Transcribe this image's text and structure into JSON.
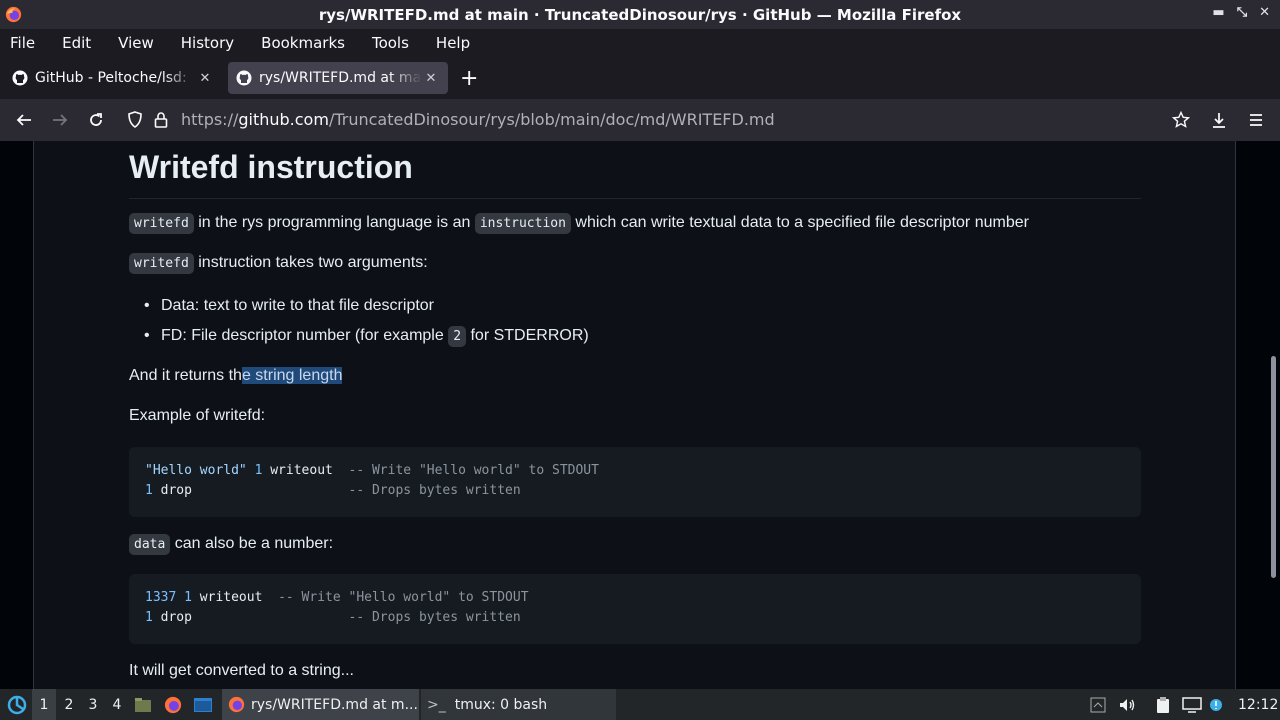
{
  "window": {
    "title": "rys/WRITEFD.md at main · TruncatedDinosour/rys · GitHub — Mozilla Firefox"
  },
  "menu": [
    "File",
    "Edit",
    "View",
    "History",
    "Bookmarks",
    "Tools",
    "Help"
  ],
  "tabs": [
    {
      "label": "GitHub - Peltoche/lsd:",
      "active": false
    },
    {
      "label": "rys/WRITEFD.md at main",
      "active": true
    }
  ],
  "url": {
    "scheme": "https://",
    "host": "github.com",
    "path": "/TruncatedDinosour/rys/blob/main/doc/md/WRITEFD.md"
  },
  "doc": {
    "heading": "Writefd instruction",
    "p1": {
      "code1": "writefd",
      "t1": " in the rys programming language is an ",
      "code2": "instruction",
      "t2": " which can write textual data to a specified file descriptor number"
    },
    "p2": {
      "code": "writefd",
      "text": " instruction takes two arguments:"
    },
    "list": {
      "item1": "Data: text to write to that file descriptor",
      "item2_pre": "FD: File descriptor number (for example ",
      "item2_code": "2",
      "item2_post": " for STDERROR)"
    },
    "p3": {
      "pre": "And it returns th",
      "selected": "e string length"
    },
    "p4": "Example of writefd:",
    "code1": {
      "l1_str": "\"Hello world\"",
      "l1_num": "1",
      "l1_cmd": " writeout  ",
      "l1_comment": "-- Write \"Hello world\" to STDOUT",
      "l2_num": "1",
      "l2_cmd": " drop                    ",
      "l2_comment": "-- Drops bytes written"
    },
    "p5": {
      "code": "data",
      "text": " can also be a number:"
    },
    "code2": {
      "l1_num": "1337",
      "l1_num2": "1",
      "l1_cmd": " writeout  ",
      "l1_comment": "-- Write \"Hello world\" to STDOUT",
      "l2_num": "1",
      "l2_cmd": " drop                    ",
      "l2_comment": "-- Drops bytes written"
    },
    "p6": "It will get converted to a string..."
  },
  "taskbar": {
    "workspaces": [
      "1",
      "2",
      "3",
      "4"
    ],
    "active_task": "rys/WRITEFD.md at m...",
    "task2": "tmux: 0 bash",
    "clock": "12:12"
  },
  "colors": {
    "accent": "#1f4a7a",
    "background": "#0d1117",
    "chrome": "#2b2a33"
  }
}
